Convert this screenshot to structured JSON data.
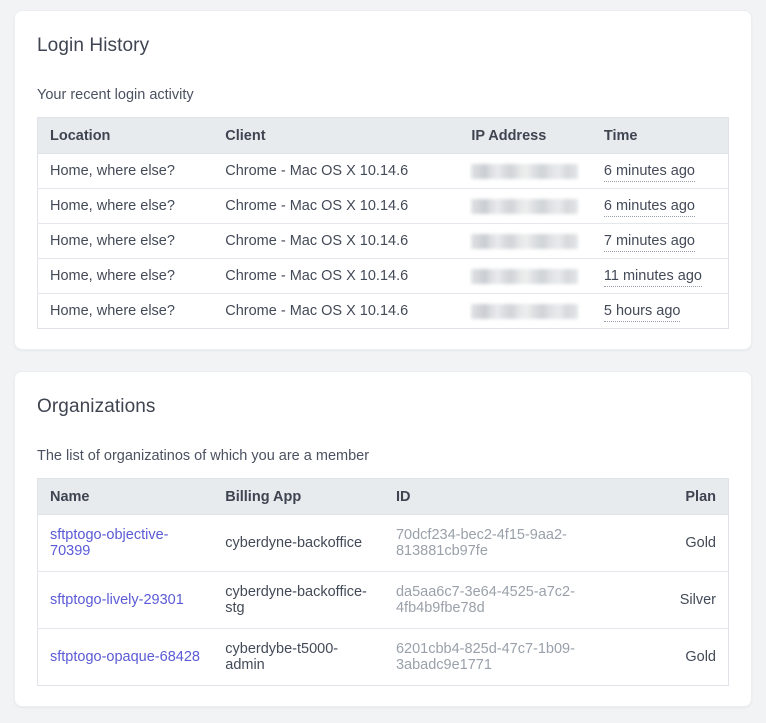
{
  "login_history": {
    "title": "Login History",
    "subtitle": "Your recent login activity",
    "columns": [
      "Location",
      "Client",
      "IP Address",
      "Time"
    ],
    "rows": [
      {
        "location": "Home, where else?",
        "client": "Chrome - Mac OS X 10.14.6",
        "ip": "",
        "time": "6 minutes ago"
      },
      {
        "location": "Home, where else?",
        "client": "Chrome - Mac OS X 10.14.6",
        "ip": "",
        "time": "6 minutes ago"
      },
      {
        "location": "Home, where else?",
        "client": "Chrome - Mac OS X 10.14.6",
        "ip": "",
        "time": "7 minutes ago"
      },
      {
        "location": "Home, where else?",
        "client": "Chrome - Mac OS X 10.14.6",
        "ip": "",
        "time": "11 minutes ago"
      },
      {
        "location": "Home, where else?",
        "client": "Chrome - Mac OS X 10.14.6",
        "ip": "",
        "time": "5 hours ago"
      }
    ]
  },
  "organizations": {
    "title": "Organizations",
    "subtitle": "The list of organizatinos of which you are a member",
    "columns": [
      "Name",
      "Billing App",
      "ID",
      "Plan"
    ],
    "rows": [
      {
        "name": "sftptogo-objective-70399",
        "billing_app": "cyberdyne-backoffice",
        "id": "70dcf234-bec2-4f15-9aa2-813881cb97fe",
        "plan": "Gold"
      },
      {
        "name": "sftptogo-lively-29301",
        "billing_app": "cyberdyne-backoffice-stg",
        "id": "da5aa6c7-3e64-4525-a7c2-4fb4b9fbe78d",
        "plan": "Silver"
      },
      {
        "name": "sftptogo-opaque-68428",
        "billing_app": "cyberdybe-t5000-admin",
        "id": "6201cbb4-825d-47c7-1b09-3abadc9e1771",
        "plan": "Gold"
      }
    ]
  },
  "colors": {
    "page_background": "#f2f3f5",
    "card_background": "#ffffff",
    "table_header_background": "#e8ebee",
    "link": "#5a5ad6",
    "text": "#434a57",
    "muted_text": "#9aa1aa",
    "border": "#dfe3e8"
  }
}
